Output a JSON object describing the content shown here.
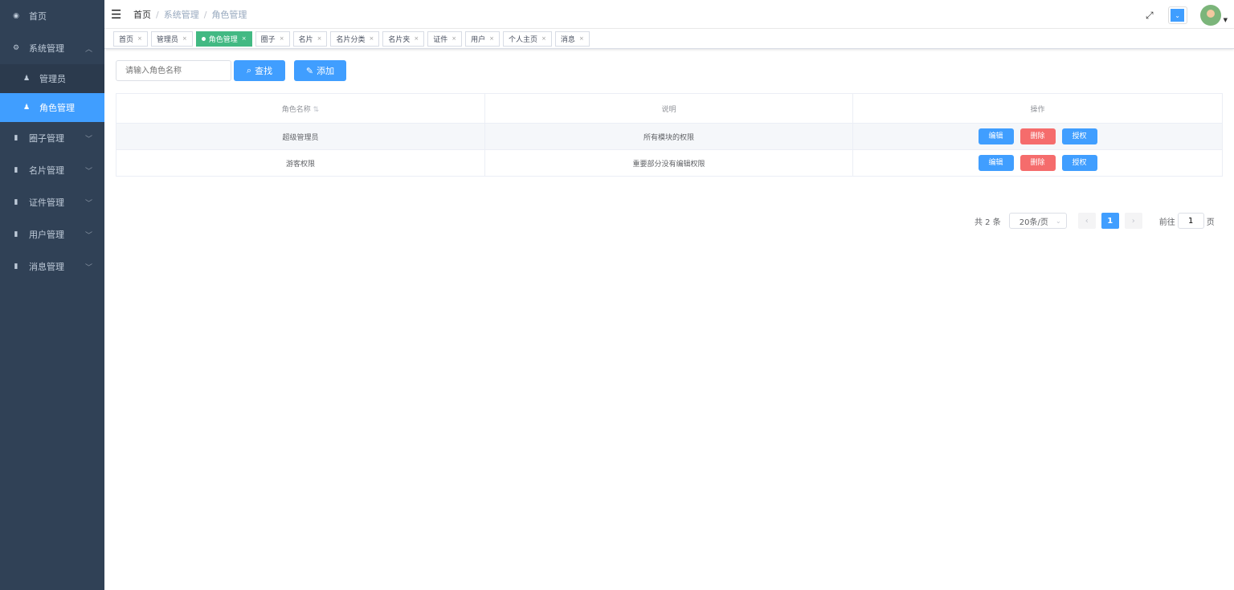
{
  "sidebar": {
    "items": [
      {
        "label": "首页",
        "icon": "dashboard-icon"
      },
      {
        "label": "系统管理",
        "icon": "gear-icon",
        "expanded": true,
        "children": [
          {
            "label": "管理员"
          },
          {
            "label": "角色管理",
            "active": true
          }
        ]
      },
      {
        "label": "圈子管理",
        "icon": "book-icon"
      },
      {
        "label": "名片管理",
        "icon": "book-icon"
      },
      {
        "label": "证件管理",
        "icon": "book-icon"
      },
      {
        "label": "用户管理",
        "icon": "book-icon"
      },
      {
        "label": "消息管理",
        "icon": "book-icon"
      }
    ]
  },
  "breadcrumb": [
    "首页",
    "系统管理",
    "角色管理"
  ],
  "tags": [
    "首页",
    "管理员",
    "角色管理",
    "圈子",
    "名片",
    "名片分类",
    "名片夹",
    "证件",
    "用户",
    "个人主页",
    "消息"
  ],
  "toolbar": {
    "search_placeholder": "请输入角色名称",
    "search_label": "查找",
    "add_label": "添加"
  },
  "table": {
    "headers": [
      "角色名称",
      "说明",
      "操作"
    ],
    "rows": [
      {
        "name": "超级管理员",
        "desc": "所有模块的权限"
      },
      {
        "name": "游客权限",
        "desc": "重要部分没有编辑权限"
      }
    ],
    "actions": {
      "edit": "编辑",
      "delete": "删除",
      "grant": "授权"
    }
  },
  "pagination": {
    "total": "共 2 条",
    "page_size": "20条/页",
    "current": "1",
    "goto_prefix": "前往",
    "goto_value": "1",
    "goto_suffix": "页"
  },
  "colors": {
    "primary": "#409eff",
    "danger": "#f56c6c",
    "tag_active": "#42b983",
    "sidebar": "#304156"
  }
}
